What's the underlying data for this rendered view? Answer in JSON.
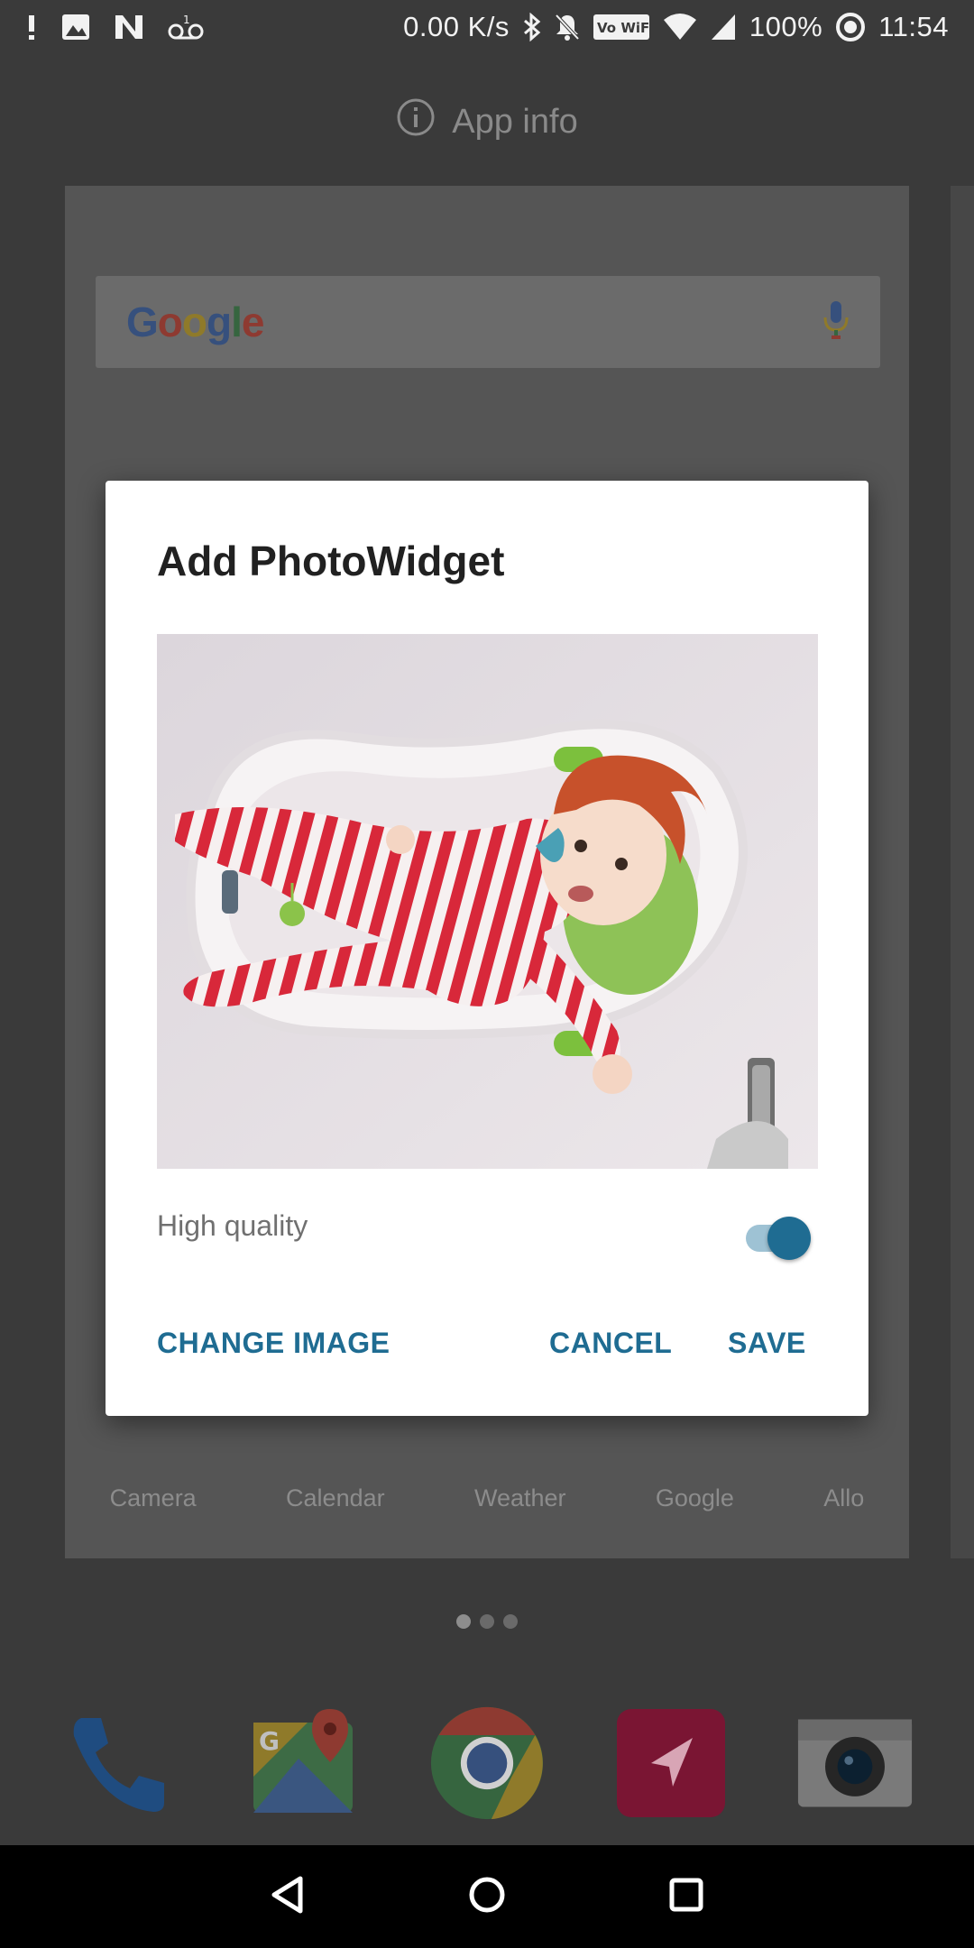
{
  "status_bar": {
    "left_icons": [
      "alert-icon",
      "image-icon",
      "n-icon",
      "voicemail-icon"
    ],
    "network_speed": "0.00 K/s",
    "right_icons": [
      "bluetooth-icon",
      "mute-icon",
      "vowifi-icon",
      "wifi-icon",
      "signal-icon"
    ],
    "vowifi_label": "Vo WiFi",
    "battery": "100%",
    "time": "11:54"
  },
  "header": {
    "icon": "info-icon",
    "label": "App info"
  },
  "background_card": {
    "search_logo": "Google",
    "apps": [
      "Camera",
      "Calendar",
      "Weather",
      "Google",
      "Allo"
    ]
  },
  "dock": {
    "icons": [
      "phone-icon",
      "maps-icon",
      "chrome-icon",
      "send-icon",
      "camera-app-icon"
    ]
  },
  "dialog": {
    "title": "Add PhotoWidget",
    "photo_alt": "photo-preview",
    "high_quality_label": "High quality",
    "high_quality_on": true,
    "change_image_label": "CHANGE IMAGE",
    "cancel_label": "CANCEL",
    "save_label": "SAVE",
    "accent_color": "#1f6c92"
  },
  "page_indicator": {
    "count": 3,
    "active": 0
  },
  "navigation": {
    "icons": [
      "back-icon",
      "home-icon",
      "recents-icon"
    ]
  }
}
